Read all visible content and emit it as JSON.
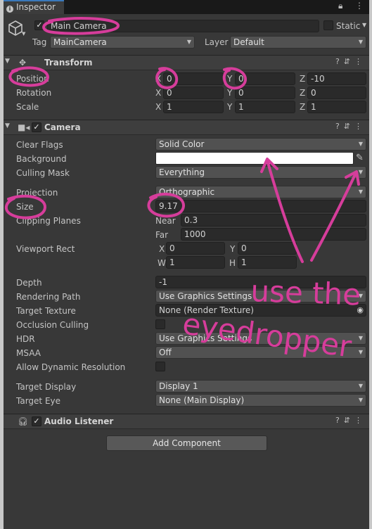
{
  "tab": {
    "label": "Inspector"
  },
  "object": {
    "name": "Main Camera",
    "active": "✓",
    "static_label": "Static",
    "tag_label": "Tag",
    "tag_value": "MainCamera",
    "layer_label": "Layer",
    "layer_value": "Default"
  },
  "transform": {
    "title": "Transform",
    "position": {
      "label": "Position",
      "x": "0",
      "y": "0",
      "z": "-10"
    },
    "rotation": {
      "label": "Rotation",
      "x": "0",
      "y": "0",
      "z": "0"
    },
    "scale": {
      "label": "Scale",
      "x": "1",
      "y": "1",
      "z": "1"
    }
  },
  "axes": {
    "x": "X",
    "y": "Y",
    "z": "Z",
    "w": "W",
    "h": "H"
  },
  "camera": {
    "title": "Camera",
    "enabled": "✓",
    "clear_flags": {
      "label": "Clear Flags",
      "value": "Solid Color"
    },
    "background": {
      "label": "Background",
      "color": "#ffffff"
    },
    "culling_mask": {
      "label": "Culling Mask",
      "value": "Everything"
    },
    "projection": {
      "label": "Projection",
      "value": "Orthographic"
    },
    "size": {
      "label": "Size",
      "value": "9.17"
    },
    "clipping": {
      "label": "Clipping Planes",
      "near_label": "Near",
      "near": "0.3",
      "far_label": "Far",
      "far": "1000"
    },
    "viewport": {
      "label": "Viewport Rect",
      "x": "0",
      "y": "0",
      "w": "1",
      "h": "1"
    },
    "depth": {
      "label": "Depth",
      "value": "-1"
    },
    "rendering_path": {
      "label": "Rendering Path",
      "value": "Use Graphics Settings"
    },
    "target_texture": {
      "label": "Target Texture",
      "value": "None (Render Texture)"
    },
    "occlusion": {
      "label": "Occlusion Culling"
    },
    "hdr": {
      "label": "HDR",
      "value": "Use Graphics Settings"
    },
    "msaa": {
      "label": "MSAA",
      "value": "Off"
    },
    "dynamic_res": {
      "label": "Allow Dynamic Resolution"
    },
    "target_display": {
      "label": "Target Display",
      "value": "Display 1"
    },
    "target_eye": {
      "label": "Target Eye",
      "value": "None (Main Display)"
    }
  },
  "audio": {
    "title": "Audio Listener",
    "enabled": "✓"
  },
  "add_component": "Add Component",
  "annotation": {
    "line1": "use the",
    "line2": "eyedropper",
    "color": "#d63d9b"
  }
}
